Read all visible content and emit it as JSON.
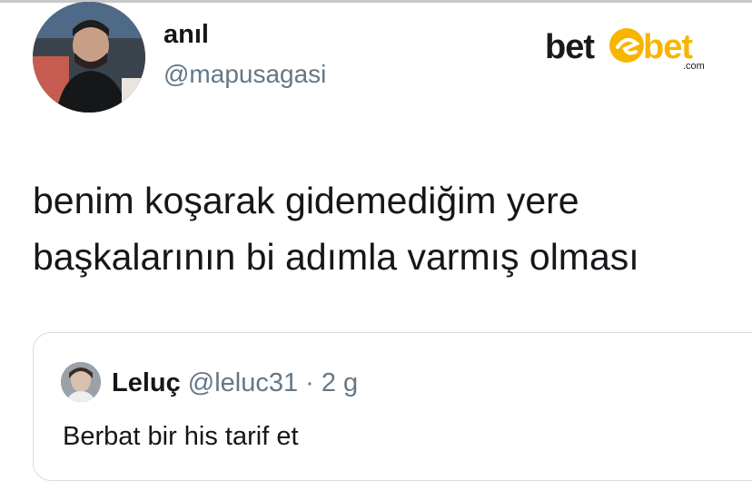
{
  "author": {
    "display_name": "anıl",
    "handle": "@mapusagasi",
    "avatar_icon": "profile-photo"
  },
  "brand": {
    "logo_text": "betebet",
    "logo_left": "bet",
    "logo_right": "bet",
    "logo_suffix": ".com",
    "accent_color": "#f7b500"
  },
  "tweet": {
    "lines": [
      "benim koşarak gidemediğim yere",
      "başkalarının bi adımla varmış olması"
    ]
  },
  "quoted_tweet": {
    "display_name": "Leluç",
    "meta": "@leluc31 · 2 g",
    "text": "Berbat bir his tarif et",
    "avatar_icon": "profile-photo"
  },
  "colors": {
    "text_primary": "#14171a",
    "text_secondary": "#657786",
    "border": "#d6dce1"
  }
}
